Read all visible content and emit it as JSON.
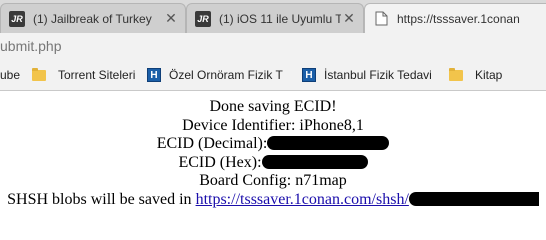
{
  "tabs": [
    {
      "title": "(1) Jailbreak of Turkey",
      "favicon": "jr-logo-icon",
      "close": "✕",
      "active": false
    },
    {
      "title": "(1) iOS 11 ile Uyumlu T",
      "favicon": "jr-logo-icon",
      "close": "✕",
      "active": false
    },
    {
      "title": "https://tsssaver.1conan",
      "favicon": "page-icon",
      "active": true
    }
  ],
  "favicon_text": "JR",
  "address_bar": {
    "url": "ubmit.php"
  },
  "bookmarks": [
    {
      "label": "ube",
      "icon": null
    },
    {
      "label": "Torrent Siteleri",
      "icon": "folder-icon"
    },
    {
      "label": "Özel Ornöram Fizik T",
      "icon": "h-icon"
    },
    {
      "label": "İstanbul Fizik Tedavi",
      "icon": "h-icon"
    },
    {
      "label": "Kitap",
      "icon": "folder-icon"
    }
  ],
  "h_icon_letter": "H",
  "page": {
    "done": "Done saving ECID!",
    "device_identifier": "Device Identifier: iPhone8,1",
    "ecid_decimal_label": "ECID (Decimal):",
    "ecid_hex_label": "ECID (Hex):",
    "board_config": "Board Config: n71map",
    "shsh_prefix": "SHSH blobs will be saved in ",
    "shsh_link": "https://tsssaver.1conan.com/shsh/"
  },
  "colors": {
    "link": "#1a0dab",
    "redaction": "#000000"
  }
}
